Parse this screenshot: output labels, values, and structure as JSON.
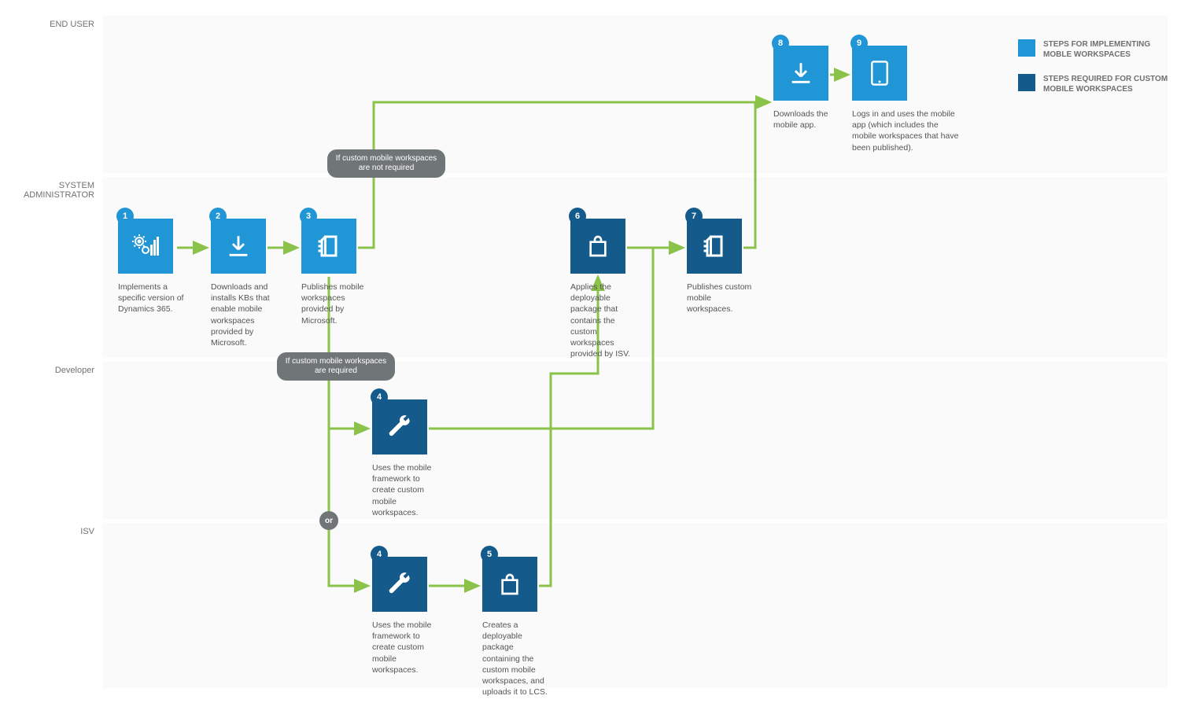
{
  "lanes": {
    "end_user": "END USER",
    "system_admin_line1": "SYSTEM",
    "system_admin_line2": "ADMINISTRATOR",
    "developer": "Developer",
    "isv": "ISV"
  },
  "steps": {
    "s1": {
      "num": "1",
      "caption": "Implements a specific version of Dynamics 365."
    },
    "s2": {
      "num": "2",
      "caption": "Downloads and installs KBs that enable mobile workspaces provided by Microsoft."
    },
    "s3": {
      "num": "3",
      "caption": "Publishes mobile workspaces provided by Microsoft."
    },
    "s4a": {
      "num": "4",
      "caption": "Uses the mobile framework to create custom mobile workspaces."
    },
    "s4b": {
      "num": "4",
      "caption": "Uses the mobile framework to create custom mobile workspaces."
    },
    "s5": {
      "num": "5",
      "caption": "Creates a deployable package containing the custom mobile workspaces, and uploads it to LCS."
    },
    "s6": {
      "num": "6",
      "caption": "Applies the deployable package that contains the custom workspaces provided by ISV."
    },
    "s7": {
      "num": "7",
      "caption": "Publishes custom mobile workspaces."
    },
    "s8": {
      "num": "8",
      "caption": "Downloads the mobile app."
    },
    "s9": {
      "num": "9",
      "caption": "Logs in and uses the mobile app (which includes the mobile workspaces that have been published)."
    }
  },
  "decisions": {
    "not_required": "If custom mobile workspaces are not required",
    "required": "If custom mobile workspaces are required",
    "or": "or"
  },
  "legend": {
    "light": "STEPS FOR IMPLEMENTING MOBLE WORKSPACES",
    "dark": "STEPS REQUIRED FOR CUSTOM MOBILE WORKSPACES"
  }
}
